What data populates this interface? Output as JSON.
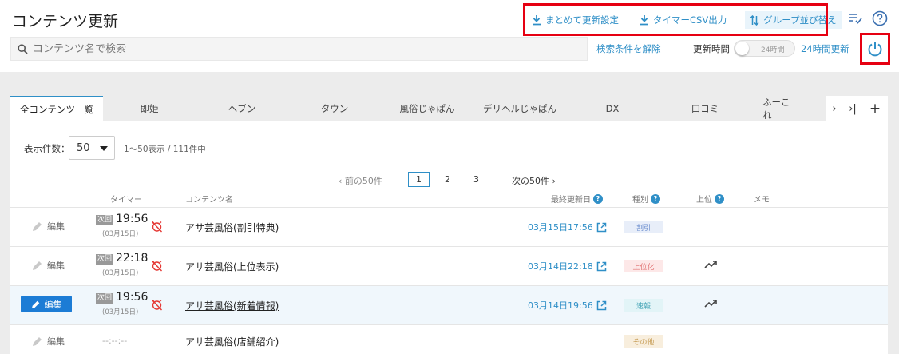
{
  "header": {
    "title": "コンテンツ更新",
    "actions": [
      {
        "label": "まとめて更新設定",
        "icon": "download-icon"
      },
      {
        "label": "タイマーCSV出力",
        "icon": "download-icon"
      },
      {
        "label": "グループ並び替え",
        "icon": "sort-arrows-icon"
      }
    ],
    "search_placeholder": "コンテンツ名で検索",
    "clear_filters": "検索条件を解除",
    "update_time_label": "更新時間",
    "toggle_label": "24時間",
    "hours_update": "24時間更新"
  },
  "tabs": [
    "全コンテンツ一覧",
    "即姫",
    "ヘブン",
    "タウン",
    "風俗じゃぱん",
    "デリヘルじゃぱん",
    "DX",
    "口コミ",
    "ふーこれ"
  ],
  "tab_nav": {
    "next": "›",
    "last": "›|",
    "add": "+"
  },
  "list": {
    "per_page_label": "表示件数：",
    "per_page_value": "50",
    "range_text": "1〜50表示 / 111件中",
    "pager": {
      "prev": "‹ 前の50件",
      "pages": [
        "1",
        "2",
        "3"
      ],
      "next": "次の50件 ›"
    },
    "columns": {
      "timer": "タイマー",
      "name": "コンテンツ名",
      "updated": "最終更新日",
      "kind": "種別",
      "top": "上位",
      "memo": "メモ"
    },
    "edit_label": "編集",
    "next_badge": "次回",
    "rows": [
      {
        "time": "19:56",
        "date": "(03月15日)",
        "name": "アサ芸風俗(割引特典)",
        "updated": "03月15日17:56",
        "kind": "割引",
        "kind_bg": "#e8eef9",
        "kind_fg": "#6d8fcf",
        "trend": false,
        "selected": false,
        "has_timer": true
      },
      {
        "time": "22:18",
        "date": "(03月15日)",
        "name": "アサ芸風俗(上位表示)",
        "updated": "03月14日22:18",
        "kind": "上位化",
        "kind_bg": "#fde8e8",
        "kind_fg": "#e07070",
        "trend": true,
        "selected": false,
        "has_timer": true
      },
      {
        "time": "19:56",
        "date": "(03月15日)",
        "name": "アサ芸風俗(新着情報)",
        "updated": "03月14日19:56",
        "kind": "速報",
        "kind_bg": "#e2f4f7",
        "kind_fg": "#4aa7b8",
        "trend": true,
        "selected": true,
        "has_timer": true
      },
      {
        "time": "",
        "date": "",
        "name": "アサ芸風俗(店舗紹介)",
        "updated": "",
        "kind": "その他",
        "kind_bg": "#f8eedd",
        "kind_fg": "#c69c55",
        "trend": false,
        "selected": false,
        "has_timer": false,
        "dashes": "--:--:--"
      }
    ]
  },
  "colors": {
    "accent": "#2f8fc7",
    "highlight": "#e60012",
    "primary": "#1c7cd5"
  }
}
